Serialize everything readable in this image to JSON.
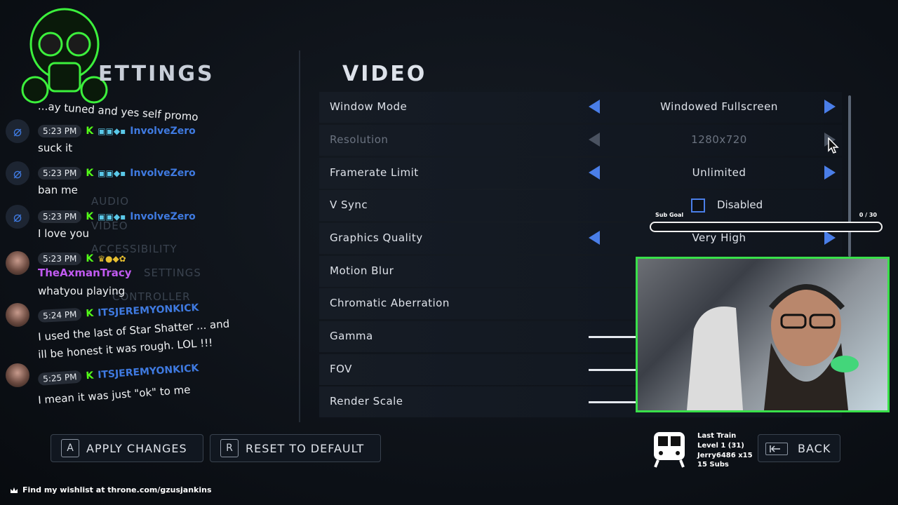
{
  "header": {
    "settings_title": "ETTINGS",
    "video_title": "VIDEO"
  },
  "menu_ghost": [
    "AUDIO",
    "VIDEO",
    "ACCESSIBILITY",
    "SETTINGS",
    "CONTROLLER"
  ],
  "rows": [
    {
      "label": "Window Mode",
      "value": "Windowed Fullscreen",
      "type": "select",
      "enabled": true
    },
    {
      "label": "Resolution",
      "value": "1280x720",
      "type": "select",
      "enabled": false
    },
    {
      "label": "Framerate Limit",
      "value": "Unlimited",
      "type": "select",
      "enabled": true
    },
    {
      "label": "V Sync",
      "value": "Disabled",
      "type": "checkbox",
      "checked": false
    },
    {
      "label": "Graphics Quality",
      "value": "Very High",
      "type": "select",
      "enabled": true
    },
    {
      "label": "Motion Blur",
      "type": "toggle"
    },
    {
      "label": "Chromatic Aberration",
      "type": "toggle"
    },
    {
      "label": "Gamma",
      "type": "slider"
    },
    {
      "label": "FOV",
      "type": "slider"
    },
    {
      "label": "Render Scale",
      "type": "slider"
    }
  ],
  "buttons": {
    "apply_key": "A",
    "apply_label": "APPLY CHANGES",
    "reset_key": "R",
    "reset_label": "RESET TO DEFAULT",
    "back_label": "BACK"
  },
  "chat": [
    {
      "partial_text": "...ay tuned and yes self promo"
    },
    {
      "time": "5:23 PM",
      "user": "InvolveZero",
      "user_color": "#3f7ae0",
      "text": "suck it"
    },
    {
      "time": "5:23 PM",
      "user": "InvolveZero",
      "user_color": "#3f7ae0",
      "text": "ban me"
    },
    {
      "time": "5:23 PM",
      "user": "InvolveZero",
      "user_color": "#3f7ae0",
      "text": "I love you"
    },
    {
      "time": "5:23 PM",
      "user": "TheAxmanTracy",
      "user_color": "#c05af0",
      "text": "whatyou playing"
    },
    {
      "time": "5:24 PM",
      "user": "ITSJEREMYONKICK",
      "user_color": "#3f7ae0",
      "text": "I used the last of Star Shatter ... and",
      "text2": "ill be honest it was rough. LOL !!!"
    },
    {
      "time": "5:25 PM",
      "user": "ITSJEREMYONKICK",
      "user_color": "#3f7ae0",
      "text": "I mean it was just \"ok\" to me"
    }
  ],
  "subgoal": {
    "label": "Sub Goal",
    "count": "0 / 30",
    "progress": 0
  },
  "train": {
    "title": "Last Train",
    "level": "Level 1  (31)",
    "user": "Jerry6486 x15",
    "subs": "15 Subs"
  },
  "footer": {
    "text": "Find my wishlist at throne.com/gzusjankins"
  },
  "colors": {
    "accent": "#4a7ee8",
    "kick_green": "#53fc18",
    "cam_border": "#39e04a"
  }
}
